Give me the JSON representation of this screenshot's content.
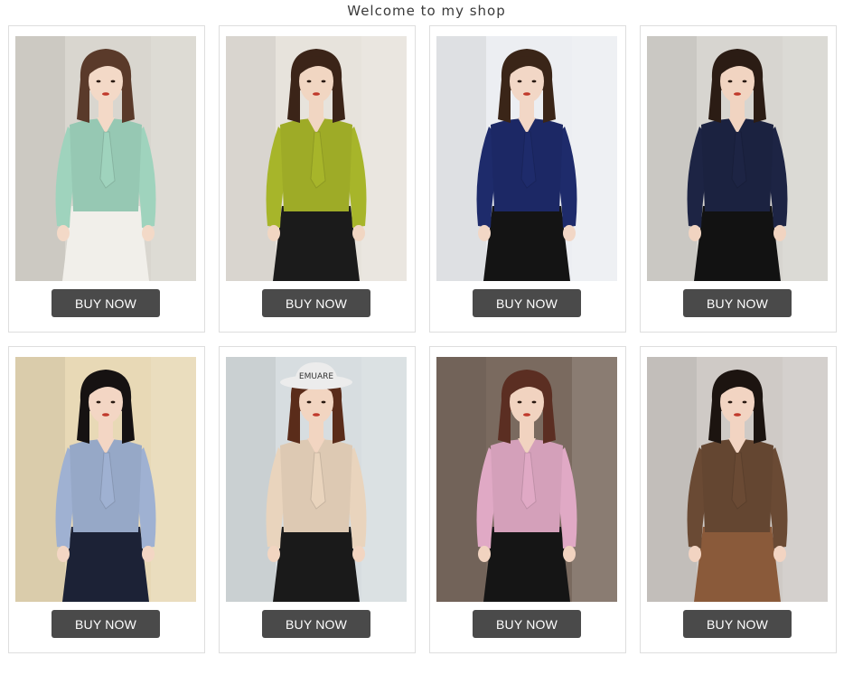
{
  "header": {
    "title": "Welcome to my shop"
  },
  "products": [
    {
      "button_label": "BUY NOW",
      "top_color": "#9fd3bd",
      "bottom_color": "#f1efea",
      "bg_color": "#d9d6cf",
      "skin": "#f3d9c7",
      "hair": "#5a3a2a"
    },
    {
      "button_label": "BUY NOW",
      "top_color": "#a7b52a",
      "bottom_color": "#1b1b1b",
      "bg_color": "#e7e3dc",
      "skin": "#f1d6c2",
      "hair": "#3b2418"
    },
    {
      "button_label": "BUY NOW",
      "top_color": "#1e2b6b",
      "bottom_color": "#141414",
      "bg_color": "#eceef2",
      "skin": "#f2d7c6",
      "hair": "#3a2518"
    },
    {
      "button_label": "BUY NOW",
      "top_color": "#1d2444",
      "bottom_color": "#121212",
      "bg_color": "#d7d5d0",
      "skin": "#f1d4c1",
      "hair": "#2b1c14"
    },
    {
      "button_label": "BUY NOW",
      "top_color": "#9fb1d2",
      "bottom_color": "#1c2236",
      "bg_color": "#e8d9b6",
      "skin": "#f3d6c4",
      "hair": "#161212"
    },
    {
      "button_label": "BUY NOW",
      "top_color": "#e9d4bd",
      "bottom_color": "#1a1a1a",
      "bg_color": "#d7dde0",
      "skin": "#f2d5c1",
      "hair": "#5a2c1a",
      "hat": "#ececec",
      "hat_text": "EMUARE"
    },
    {
      "button_label": "BUY NOW",
      "top_color": "#e0a9c5",
      "bottom_color": "#151515",
      "bg_color": "#7a6a5f",
      "skin": "#f1d3c0",
      "hair": "#5b2e22"
    },
    {
      "button_label": "BUY NOW",
      "top_color": "#6a4a34",
      "bottom_color": "#8a5a3a",
      "bg_color": "#cfcac6",
      "skin": "#f2d4c2",
      "hair": "#1c1410"
    }
  ]
}
